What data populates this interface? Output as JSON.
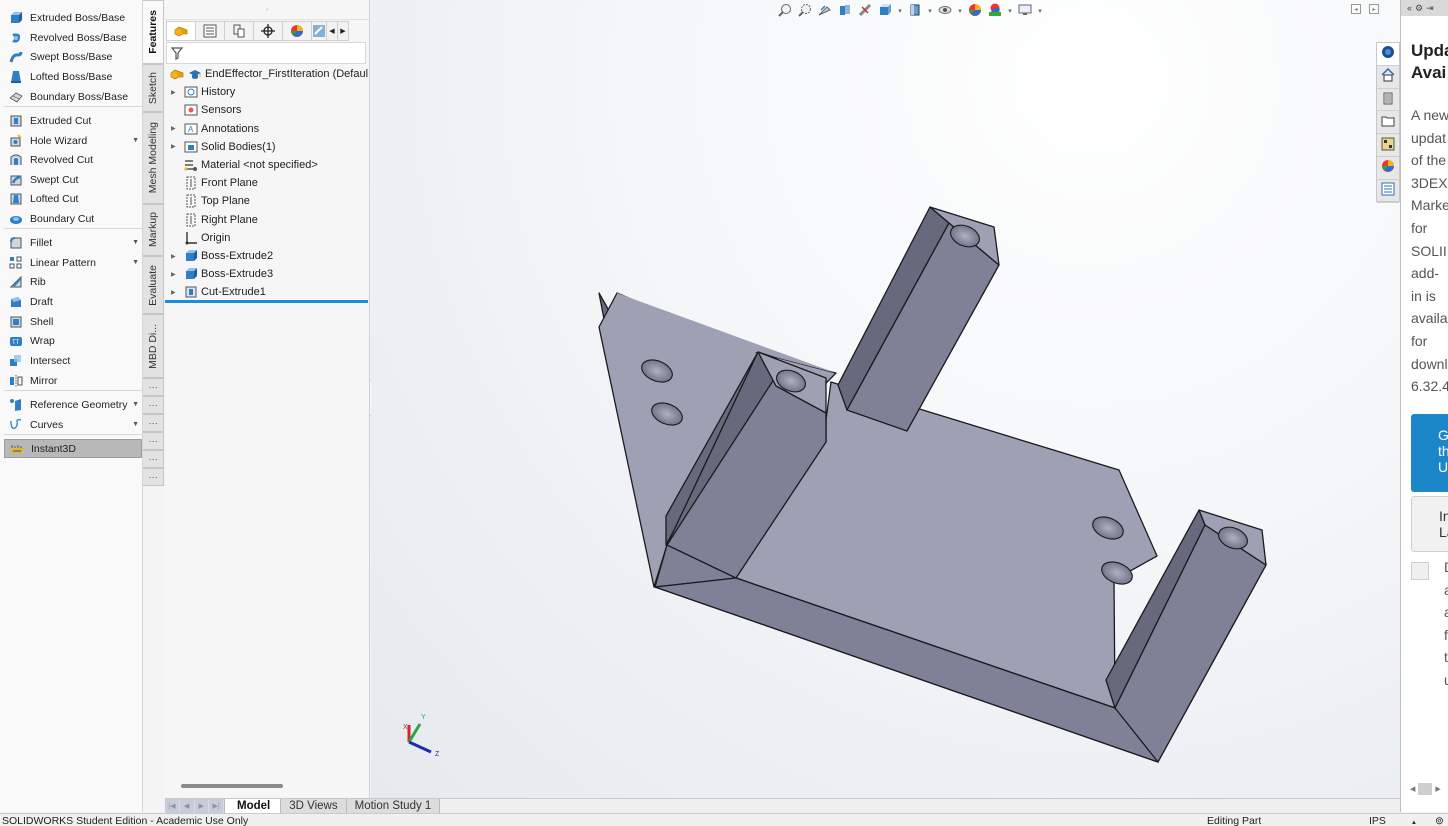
{
  "app": {
    "name": "SOLIDWORKS",
    "status_left": "SOLIDWORKS Student Edition - Academic Use Only",
    "status_mode": "Editing Part",
    "status_units": "IPS",
    "status_caret": "▲"
  },
  "command_manager": {
    "items": [
      {
        "label": "Extruded Boss/Base",
        "icon": "extruded-boss-icon",
        "has_menu": false
      },
      {
        "label": "Revolved Boss/Base",
        "icon": "revolved-boss-icon",
        "has_menu": false
      },
      {
        "label": "Swept Boss/Base",
        "icon": "swept-boss-icon",
        "has_menu": false
      },
      {
        "label": "Lofted Boss/Base",
        "icon": "lofted-boss-icon",
        "has_menu": false
      },
      {
        "label": "Boundary Boss/Base",
        "icon": "boundary-boss-icon",
        "has_menu": false
      },
      {
        "label": "Extruded Cut",
        "icon": "extruded-cut-icon",
        "has_menu": false
      },
      {
        "label": "Hole Wizard",
        "icon": "hole-wizard-icon",
        "has_menu": true
      },
      {
        "label": "Revolved Cut",
        "icon": "revolved-cut-icon",
        "has_menu": false
      },
      {
        "label": "Swept Cut",
        "icon": "swept-cut-icon",
        "has_menu": false
      },
      {
        "label": "Lofted Cut",
        "icon": "lofted-cut-icon",
        "has_menu": false
      },
      {
        "label": "Boundary Cut",
        "icon": "boundary-cut-icon",
        "has_menu": false
      },
      {
        "label": "Fillet",
        "icon": "fillet-icon",
        "has_menu": true
      },
      {
        "label": "Linear Pattern",
        "icon": "linear-pattern-icon",
        "has_menu": true
      },
      {
        "label": "Rib",
        "icon": "rib-icon",
        "has_menu": false
      },
      {
        "label": "Draft",
        "icon": "draft-icon",
        "has_menu": false
      },
      {
        "label": "Shell",
        "icon": "shell-icon",
        "has_menu": false
      },
      {
        "label": "Wrap",
        "icon": "wrap-icon",
        "has_menu": false
      },
      {
        "label": "Intersect",
        "icon": "intersect-icon",
        "has_menu": false
      },
      {
        "label": "Mirror",
        "icon": "mirror-icon",
        "has_menu": false
      },
      {
        "label": "Reference Geometry",
        "icon": "reference-geometry-icon",
        "has_menu": true
      },
      {
        "label": "Curves",
        "icon": "curves-icon",
        "has_menu": true
      },
      {
        "label": "Instant3D",
        "icon": "instant3d-icon",
        "has_menu": false,
        "active": true
      }
    ],
    "tabs": [
      {
        "label": "Features",
        "active": true
      },
      {
        "label": "Sketch"
      },
      {
        "label": "Mesh Modeling"
      },
      {
        "label": "Markup"
      },
      {
        "label": "Evaluate"
      },
      {
        "label": "MBD Di..."
      },
      {
        "label": "⋮"
      },
      {
        "label": "⋮"
      },
      {
        "label": "⋮"
      },
      {
        "label": "⋮"
      },
      {
        "label": "⋮"
      },
      {
        "label": "⋮"
      }
    ]
  },
  "feature_manager": {
    "tabs": [
      "feature-manager-tab",
      "property-manager-tab",
      "configuration-manager-tab",
      "dimxpert-manager-tab",
      "display-manager-tab",
      "cam-tab"
    ],
    "filter_icon": "filter-icon",
    "tree": [
      {
        "label": "EndEffector_FirstIteration  (Defaul",
        "icon": "part-icon",
        "expand": false,
        "root": true
      },
      {
        "label": "History",
        "icon": "history-folder-icon",
        "expand": true
      },
      {
        "label": "Sensors",
        "icon": "sensors-folder-icon",
        "expand": false
      },
      {
        "label": "Annotations",
        "icon": "annotations-folder-icon",
        "expand": true
      },
      {
        "label": "Solid Bodies(1)",
        "icon": "solid-bodies-folder-icon",
        "expand": true
      },
      {
        "label": "Material <not specified>",
        "icon": "material-icon",
        "expand": false
      },
      {
        "label": "Front Plane",
        "icon": "plane-icon",
        "expand": false
      },
      {
        "label": "Top Plane",
        "icon": "plane-icon",
        "expand": false
      },
      {
        "label": "Right Plane",
        "icon": "plane-icon",
        "expand": false
      },
      {
        "label": "Origin",
        "icon": "origin-icon",
        "expand": false
      },
      {
        "label": "Boss-Extrude2",
        "icon": "boss-extrude-icon",
        "expand": true
      },
      {
        "label": "Boss-Extrude3",
        "icon": "boss-extrude-icon",
        "expand": true
      },
      {
        "label": "Cut-Extrude1",
        "icon": "cut-extrude-icon",
        "expand": true
      }
    ]
  },
  "heads_up_toolbar": {
    "buttons": [
      {
        "icon": "zoom-to-fit-icon",
        "caret": false
      },
      {
        "icon": "zoom-to-area-icon",
        "caret": false
      },
      {
        "icon": "previous-view-icon",
        "caret": false
      },
      {
        "icon": "section-view-icon",
        "caret": false
      },
      {
        "icon": "dynamic-annotation-icon",
        "caret": false
      },
      {
        "icon": "view-orientation-icon",
        "caret": true
      },
      {
        "icon": "display-style-icon",
        "caret": true
      },
      {
        "icon": "hide-show-items-icon",
        "caret": true
      },
      {
        "icon": "edit-appearance-icon",
        "caret": false
      },
      {
        "icon": "apply-scene-icon",
        "caret": true
      },
      {
        "icon": "view-settings-icon",
        "caret": true
      }
    ]
  },
  "triad": {
    "x": "X",
    "y": "Y",
    "z": "Z"
  },
  "bottom_tabs": [
    {
      "label": "Model",
      "active": true
    },
    {
      "label": "3D Views"
    },
    {
      "label": "Motion Study 1"
    }
  ],
  "task_pane": {
    "header": "«",
    "title": "Upda Avai",
    "title_lines": [
      "Upda",
      "Avai"
    ],
    "body_lines": [
      "A new",
      "updat",
      "of the",
      "3DEX",
      "Marke",
      "for",
      "SOLII",
      "add-",
      "in is",
      "availa",
      "for",
      "downl",
      "6.32.4"
    ],
    "primary_button_lines": [
      "G",
      "th",
      "U"
    ],
    "secondary_button_lines": [
      "In",
      "La"
    ],
    "checkbox_checked": false,
    "checkbox_text_lines": [
      "D",
      "a",
      "a",
      "f",
      "t",
      "u"
    ],
    "tabs": [
      "solidworks-resources-icon",
      "home-icon",
      "design-library-icon",
      "file-explorer-icon",
      "view-palette-icon",
      "appearances-icon",
      "custom-properties-icon"
    ],
    "colors": {
      "primary_button": "#1b87c9"
    }
  },
  "colors": {
    "rollback_bar": "#1a8fd8",
    "model_face_light": "#9ea1b4",
    "model_face_mid": "#7f8296",
    "model_face_dark": "#676a7c"
  }
}
